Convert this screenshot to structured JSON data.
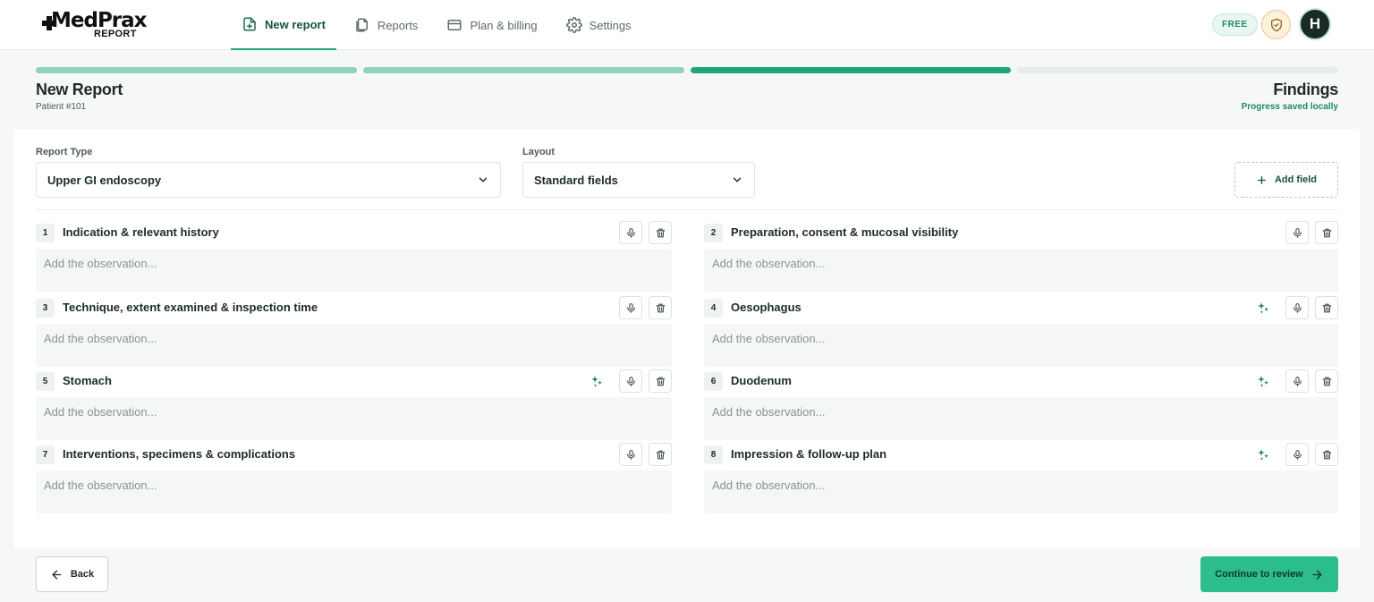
{
  "brand": {
    "name": "MedPrax",
    "sub": "REPORT"
  },
  "nav": [
    {
      "label": "New report",
      "icon": "file-plus-icon",
      "active": true
    },
    {
      "label": "Reports",
      "icon": "files-icon",
      "active": false
    },
    {
      "label": "Plan & billing",
      "icon": "credit-card-icon",
      "active": false
    },
    {
      "label": "Settings",
      "icon": "gear-icon",
      "active": false
    }
  ],
  "header_right": {
    "badge": "FREE",
    "avatar": "H"
  },
  "page": {
    "title": "New Report",
    "patient": "Patient #101",
    "step_title": "Findings",
    "saved": "Progress saved locally"
  },
  "steps": {
    "total": 4,
    "current": 3
  },
  "form": {
    "report_type_label": "Report Type",
    "report_type_value": "Upper GI endoscopy",
    "layout_label": "Layout",
    "layout_value": "Standard fields",
    "add_field": "Add field"
  },
  "fields": [
    {
      "num": "1",
      "name": "Indication & relevant history",
      "placeholder": "Add the observation...",
      "ai": false
    },
    {
      "num": "2",
      "name": "Preparation, consent & mucosal visibility",
      "placeholder": "Add the observation...",
      "ai": false
    },
    {
      "num": "3",
      "name": "Technique, extent examined & inspection time",
      "placeholder": "Add the observation...",
      "ai": false
    },
    {
      "num": "4",
      "name": "Oesophagus",
      "placeholder": "Add the observation...",
      "ai": true
    },
    {
      "num": "5",
      "name": "Stomach",
      "placeholder": "Add the observation...",
      "ai": true
    },
    {
      "num": "6",
      "name": "Duodenum",
      "placeholder": "Add the observation...",
      "ai": true
    },
    {
      "num": "7",
      "name": "Interventions, specimens & complications",
      "placeholder": "Add the observation...",
      "ai": false
    },
    {
      "num": "8",
      "name": "Impression & follow-up plan",
      "placeholder": "Add the observation...",
      "ai": true
    }
  ],
  "footer": {
    "back": "Back",
    "continue": "Continue to review"
  },
  "colors": {
    "accent": "#1fa67a",
    "accent_light": "#8fd3b9",
    "primary_button": "#2bbd8a"
  }
}
